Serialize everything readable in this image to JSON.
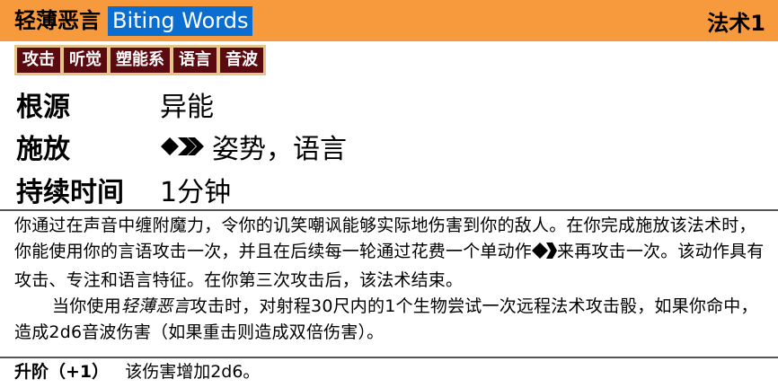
{
  "header": {
    "title_cn": "轻薄恶言",
    "title_en": "Biting Words",
    "level": "法术1",
    "colors": {
      "header_bg": "#f79a3e",
      "title_highlight": "#0a6ed1",
      "trait_bg": "#5b0a10",
      "trait_border": "#e6c48a"
    }
  },
  "traits": [
    "攻击",
    "听觉",
    "塑能系",
    "语言",
    "音波"
  ],
  "stats": {
    "source": {
      "label": "根源",
      "value": "异能"
    },
    "cast": {
      "label": "施放",
      "icon": "two-actions-icon",
      "value": "姿势，语言"
    },
    "duration": {
      "label": "持续时间",
      "value": "1分钟"
    }
  },
  "description": {
    "p1_a": "你通过在声音中缠附魔力，令你的讥笑嘲讽能够实际地伤害到你的敌人。在你完成施放该法术时，你能使用你的言语攻击一次，并且在后续每一轮通过花费一个单动作",
    "p1_icon": "single-action-icon",
    "p1_b": "来再攻击一次。该动作具有攻击、专注和语言特征。在你第三次攻击后，该法术结束。",
    "p2_a": "当你使用",
    "p2_italic": "轻薄恶言",
    "p2_b": "攻击时，对射程30尺内的1个生物尝试一次远程法术攻击骰，如果你命中，造成2d6音波伤害（如果重击则造成双倍伤害）。"
  },
  "heighten": {
    "label": "升阶（+1）",
    "text": "该伤害增加2d6。"
  }
}
